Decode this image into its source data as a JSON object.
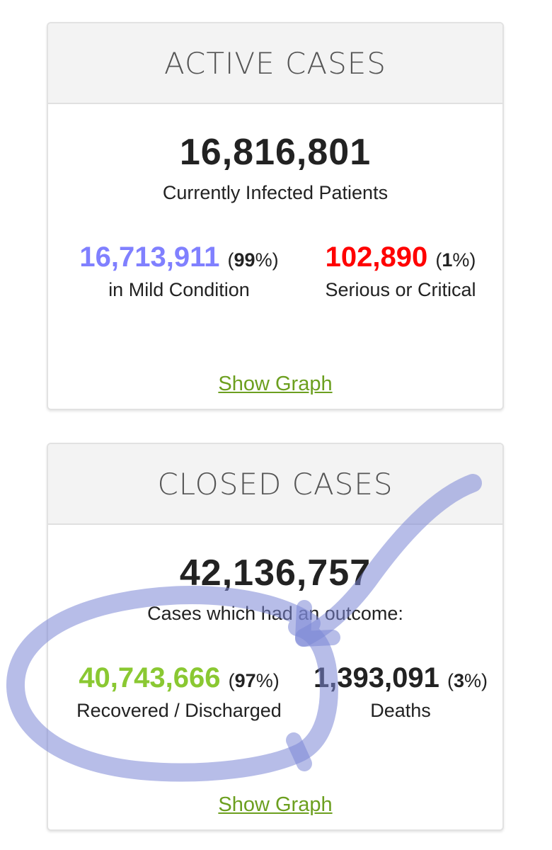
{
  "active": {
    "title": "ACTIVE CASES",
    "total": "16,816,801",
    "total_label": "Currently Infected Patients",
    "left": {
      "value": "16,713,911",
      "pct_open": "(",
      "pct": "99",
      "pct_close": "%)",
      "label": "in Mild Condition",
      "color": "#8080ff"
    },
    "right": {
      "value": "102,890",
      "pct_open": "(",
      "pct": "1",
      "pct_close": "%)",
      "label": "Serious or Critical",
      "color": "#ff0000"
    },
    "link": "Show Graph"
  },
  "closed": {
    "title": "CLOSED CASES",
    "total": "42,136,757",
    "total_label": "Cases which had an outcome:",
    "left": {
      "value": "40,743,666",
      "pct_open": "(",
      "pct": "97",
      "pct_close": "%)",
      "label": "Recovered / Discharged",
      "color": "#8ac832"
    },
    "right": {
      "value": "1,393,091",
      "pct_open": "(",
      "pct": "3",
      "pct_close": "%)",
      "label": "Deaths",
      "color": "#222222"
    },
    "link": "Show Graph"
  },
  "annotation": {
    "type": "hand-drawn circle with arrow",
    "color": "#7b86d6"
  }
}
